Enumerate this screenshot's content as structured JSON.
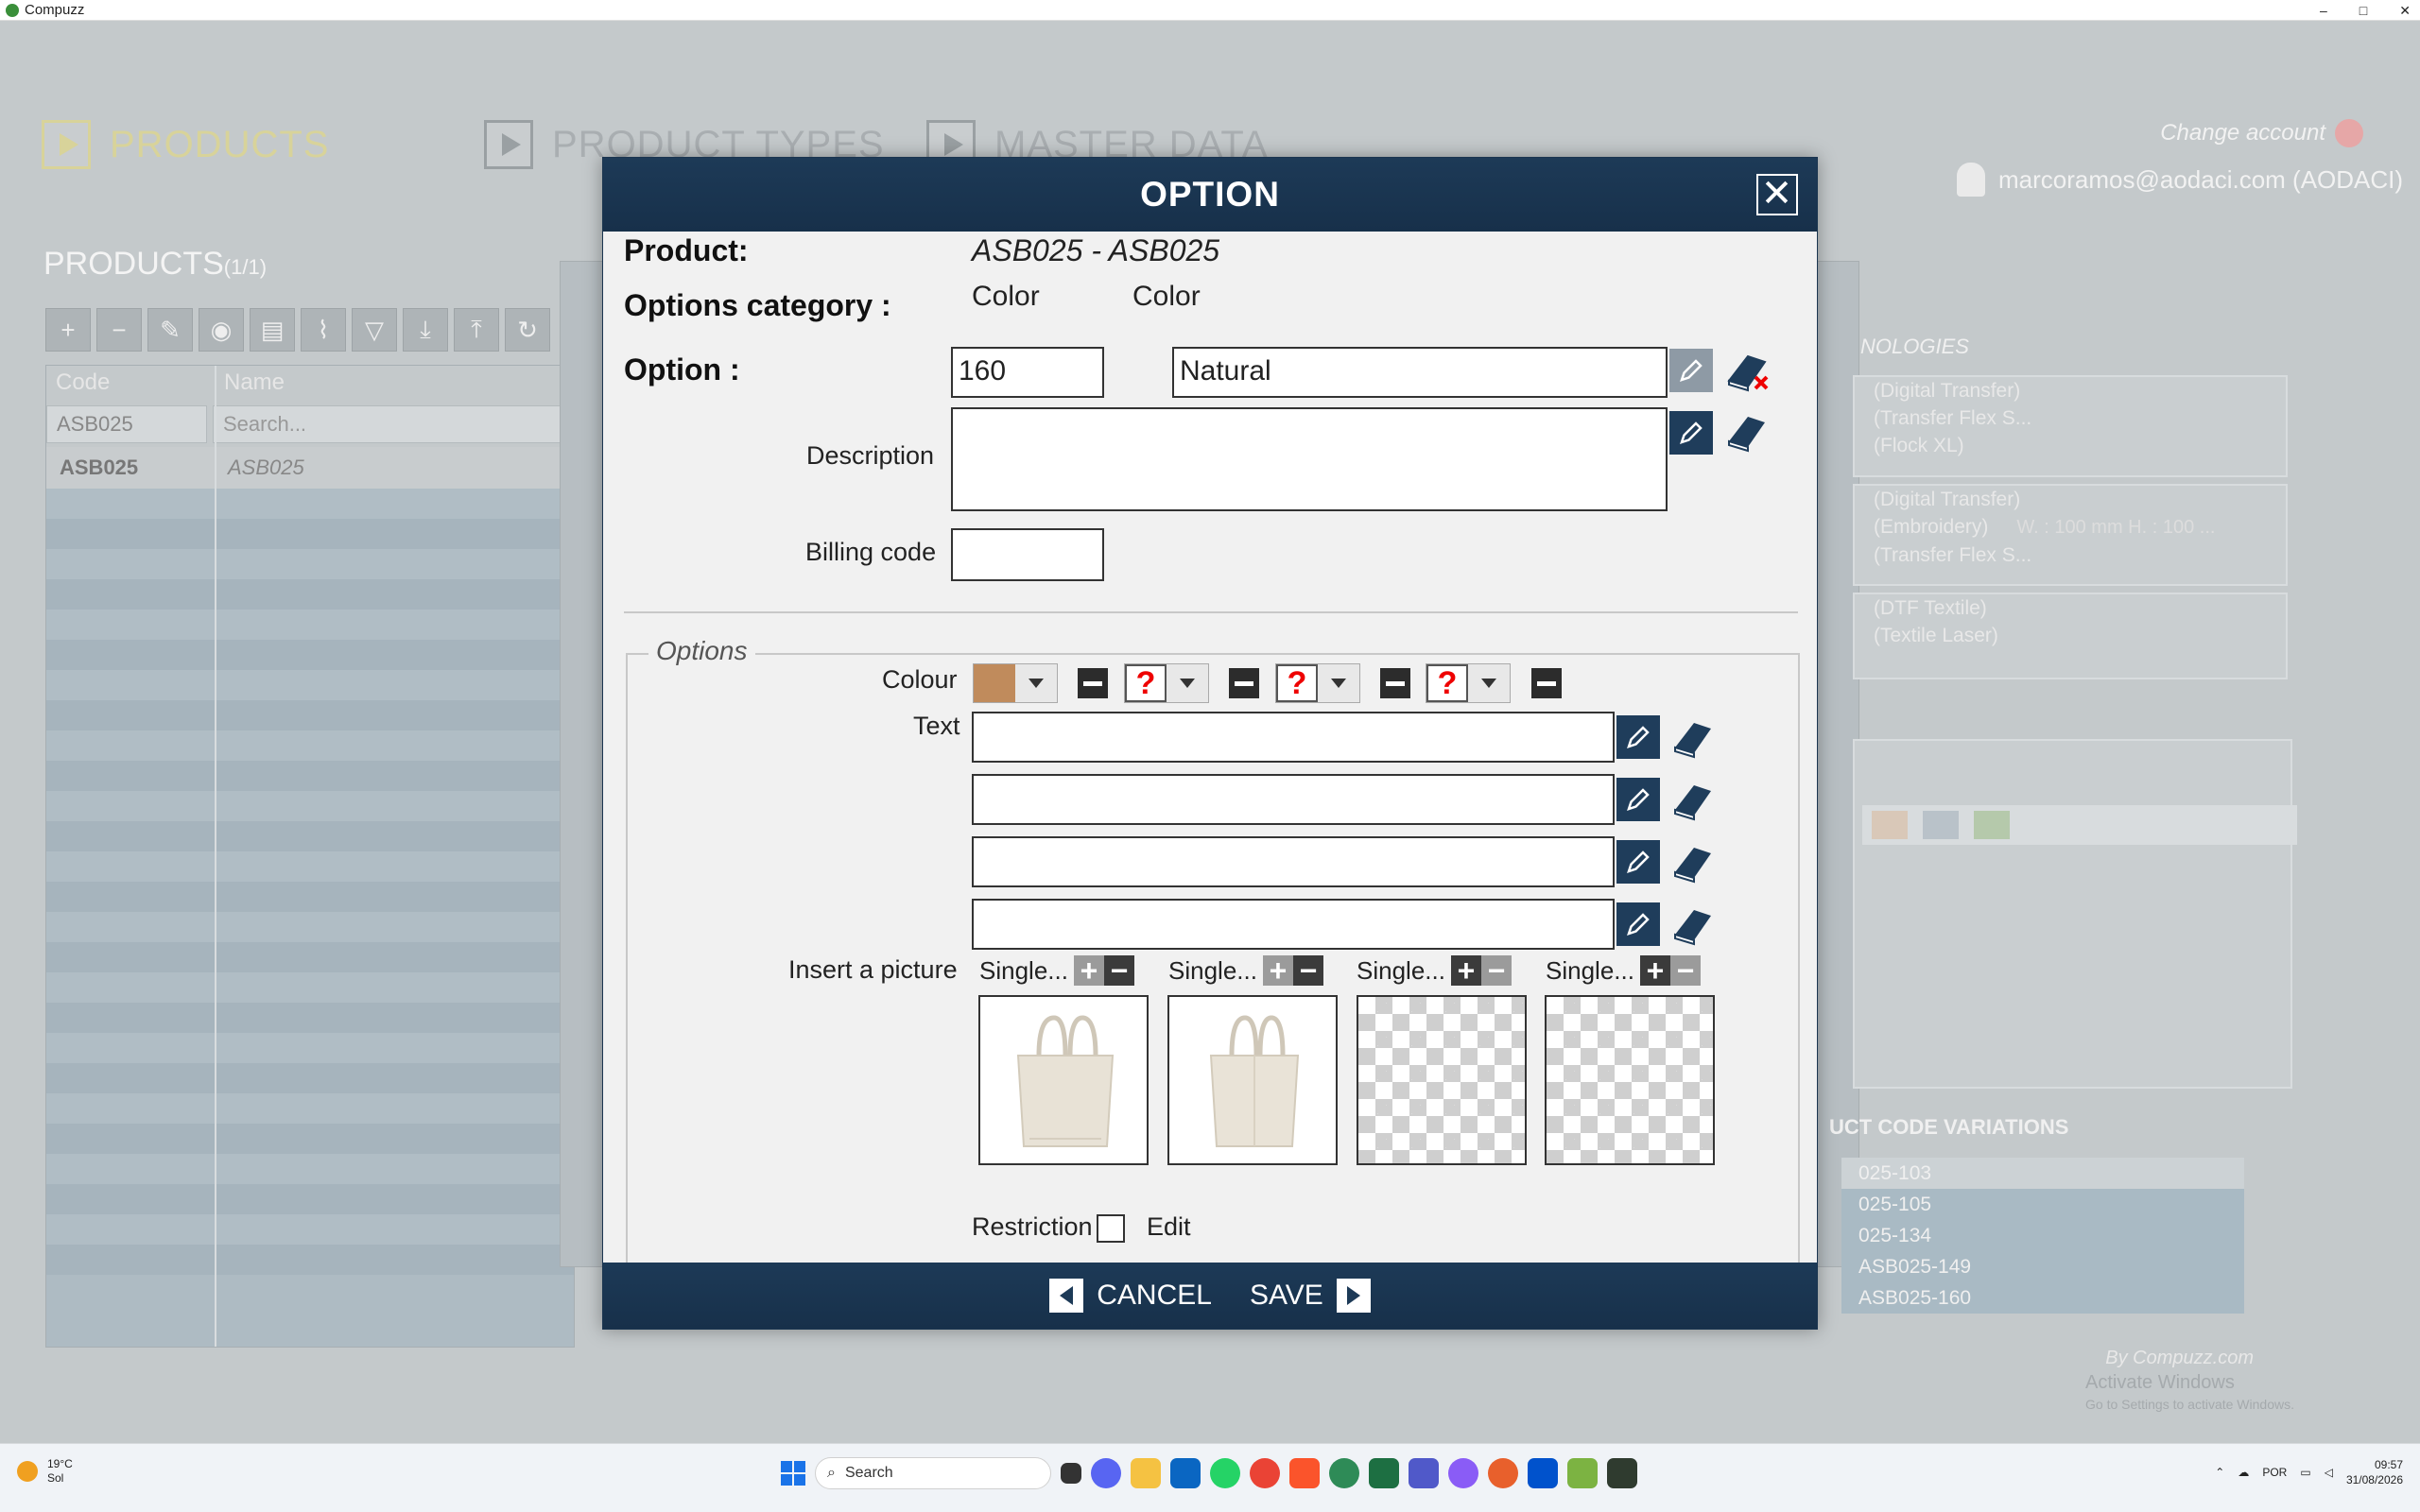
{
  "window": {
    "title": "Compuzz",
    "controls": [
      "–",
      "□",
      "✕"
    ]
  },
  "nav": {
    "tabs": [
      {
        "label": "PRODUCTS",
        "active": true
      },
      {
        "label": "PRODUCT TYPES",
        "active": false
      },
      {
        "label": "MASTER DATA",
        "active": false
      }
    ],
    "change_account": "Change account",
    "user": "marcoramos@aodaci.com (AODACI)"
  },
  "products": {
    "title": "PRODUCTS",
    "count": "(1/1)",
    "columns": [
      "Code",
      "Name"
    ],
    "code_filter": "ASB025",
    "search_placeholder": "Search...",
    "row": {
      "code": "ASB025",
      "name": "ASB025"
    }
  },
  "right": {
    "technologies_title": "NOLOGIES",
    "tech_group1": [
      "(Digital Transfer)",
      "(Transfer Flex S...",
      "(Flock XL)"
    ],
    "tech_group2": [
      "(Digital Transfer)",
      "(Embroidery)",
      "(Transfer Flex S..."
    ],
    "tech_group2_size": "W. : 100 mm H. : 100 ...",
    "tech_group3": [
      "(DTF Textile)",
      "(Textile Laser)"
    ],
    "code_variations_title": "UCT CODE VARIATIONS",
    "code_variations": [
      "025-103",
      "025-105",
      "025-134",
      "ASB025-149",
      "ASB025-160"
    ],
    "by": "By Compuzz.com",
    "activate_title": "Activate Windows",
    "activate_sub": "Go to Settings to activate Windows."
  },
  "modal": {
    "title": "OPTION",
    "product_label": "Product:",
    "product_value": "ASB025 - ASB025",
    "category_label": "Options category :",
    "category_value1": "Color",
    "category_value2": "Color",
    "option_label": "Option :",
    "option_code": "160",
    "option_name": "Natural",
    "description_label": "Description",
    "description_value": "",
    "billing_label": "Billing code",
    "billing_value": "",
    "options_legend": "Options",
    "colour_label": "Colour",
    "colour_swatch": "#c08b5c",
    "text_label": "Text",
    "picture_label": "Insert a picture",
    "picture_slots": [
      "Single...",
      "Single...",
      "Single...",
      "Single..."
    ],
    "restriction_label": "Restriction",
    "edit_label": "Edit",
    "cancel_label": "CANCEL",
    "save_label": "SAVE"
  },
  "taskbar": {
    "temp": "19°C",
    "weather": "Sol",
    "search": "Search",
    "lang": "POR",
    "time": "09:57",
    "date": "31/08/2026"
  },
  "colors": {
    "header": "#1d3a57",
    "accent_tab": "#d8d39a",
    "error_red": "#e00000"
  }
}
